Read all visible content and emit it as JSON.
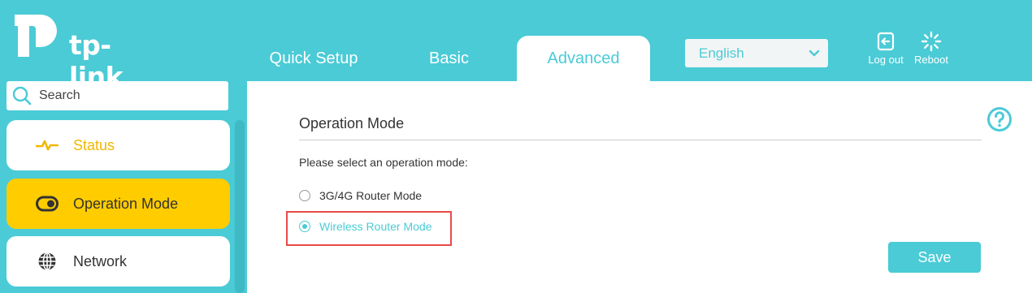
{
  "brand": {
    "name": "tp-link"
  },
  "nav": {
    "tabs": [
      {
        "label": "Quick Setup",
        "active": false
      },
      {
        "label": "Basic",
        "active": false
      },
      {
        "label": "Advanced",
        "active": true
      }
    ]
  },
  "language": {
    "selected": "English"
  },
  "header_actions": {
    "logout_label": "Log out",
    "reboot_label": "Reboot"
  },
  "sidebar": {
    "search": {
      "placeholder": "Search",
      "value": ""
    },
    "items": [
      {
        "label": "Status",
        "icon": "pulse-icon",
        "active": false
      },
      {
        "label": "Operation Mode",
        "icon": "toggle-icon",
        "active": true
      },
      {
        "label": "Network",
        "icon": "globe-icon",
        "active": false
      }
    ]
  },
  "main": {
    "section_title": "Operation Mode",
    "prompt": "Please select an operation mode:",
    "options": [
      {
        "label": "3G/4G Router Mode",
        "selected": false
      },
      {
        "label": "Wireless Router Mode",
        "selected": true
      }
    ],
    "save_label": "Save"
  },
  "colors": {
    "accent": "#4acbd6",
    "active_menu": "#ffcc00",
    "status_text": "#f2b700",
    "highlight_border": "#e84a4a"
  }
}
